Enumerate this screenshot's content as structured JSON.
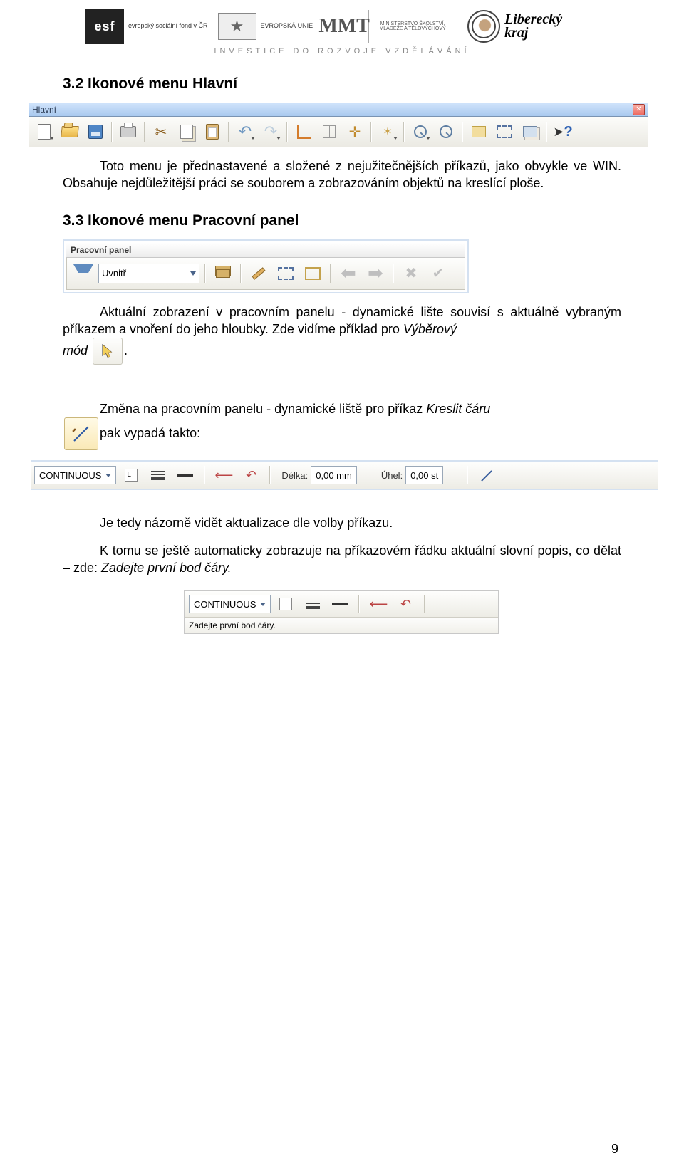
{
  "header": {
    "logos": {
      "esf_block": "esf",
      "esf_text": "evropský\nsociální\nfond v ČR",
      "eu_label": "EVROPSKÁ UNIE",
      "ministry": "MINISTERSTVO ŠKOLSTVÍ, MLÁDEŽE A TĚLOVÝCHOVY",
      "mmt": "MMT",
      "liberecky": "Liberecký",
      "kraj": "kraj"
    },
    "tagline": "INVESTICE DO ROZVOJE VZDĚLÁVÁNÍ"
  },
  "section32": {
    "title": "3.2 Ikonové menu Hlavní",
    "p1": "Toto menu je přednastavené a složené z nejužitečnějších příkazů, jako obvykle ve WIN. Obsahuje nejdůležitější práci se souborem a zobrazováním objektů na kreslící ploše."
  },
  "toolbar_hlavni": {
    "title": "Hlavní"
  },
  "section33": {
    "title": "3.3 Ikonové menu Pracovní panel",
    "pp_title": "Pracovní panel",
    "pp_select": "Uvnitř",
    "p1a": "Aktuální zobrazení v pracovním panelu - dynamické lište souvisí s aktuálně vybraným příkazem a vnoření do jeho hloubky. Zde vidíme příklad pro ",
    "p1b": "Výběrový",
    "p1c": "mód",
    "p1d": ".",
    "p2a": "Změna na pracovním panelu - dynamické liště pro příkaz ",
    "p2b": "Kreslit čáru",
    "p2c": "pak vypadá takto:"
  },
  "dynbar": {
    "linetype": "CONTINUOUS",
    "length_label": "Délka:",
    "length_value": "0,00 mm",
    "angle_label": "Úhel:",
    "angle_value": "0,00 st"
  },
  "after": {
    "p3": "Je tedy názorně vidět aktualizace dle volby příkazu.",
    "p4a": "K tomu se ještě automaticky zobrazuje na příkazovém řádku aktuální slovní popis, co dělat – zde: ",
    "p4b": "Zadejte první bod čáry."
  },
  "zoombar": {
    "linetype": "CONTINUOUS",
    "msg": "Zadejte první bod čáry."
  },
  "page_number": "9"
}
